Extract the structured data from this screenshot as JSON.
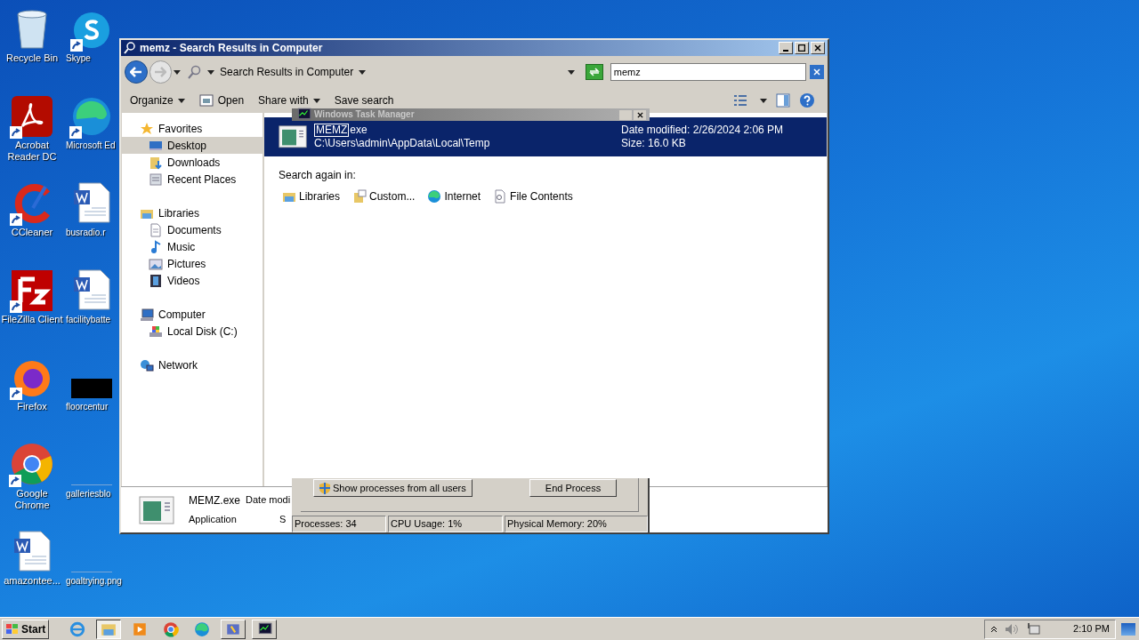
{
  "desktop_icons": [
    {
      "label": "Recycle Bin",
      "kind": "bin"
    },
    {
      "label": "Skype",
      "kind": "skype"
    },
    {
      "label": "Acrobat Reader DC",
      "kind": "acrobat"
    },
    {
      "label": "Microsoft Ed",
      "kind": "edge"
    },
    {
      "label": "CCleaner",
      "kind": "ccleaner"
    },
    {
      "label": "busradio.r",
      "kind": "word"
    },
    {
      "label": "FileZilla Client",
      "kind": "filezilla"
    },
    {
      "label": "facilitybatte",
      "kind": "word"
    },
    {
      "label": "Firefox",
      "kind": "firefox"
    },
    {
      "label": "floorcentur",
      "kind": "black"
    },
    {
      "label": "Google Chrome",
      "kind": "chrome"
    },
    {
      "label": "galleriesblo",
      "kind": "blank"
    },
    {
      "label": "amazontee...",
      "kind": "word"
    },
    {
      "label": "goaltrying.png",
      "kind": "blank"
    }
  ],
  "explorer": {
    "title": "memz - Search Results in Computer",
    "address": "Search Results in Computer",
    "search": {
      "value": "memz"
    },
    "toolbar": [
      {
        "label": "Organize",
        "kind": "menu"
      },
      {
        "label": "Open",
        "kind": "open"
      },
      {
        "label": "Share with",
        "kind": "menu"
      },
      {
        "label": "Save search",
        "kind": "plain"
      }
    ],
    "nav": [
      {
        "label": "Favorites",
        "kind": "star",
        "selected": false,
        "children": [
          {
            "label": "Desktop",
            "kind": "desktop",
            "selected": true
          },
          {
            "label": "Downloads",
            "kind": "downloads",
            "selected": false
          },
          {
            "label": "Recent Places",
            "kind": "recent",
            "selected": false
          }
        ]
      },
      {
        "label": "Libraries",
        "kind": "libraries",
        "selected": false,
        "children": [
          {
            "label": "Documents",
            "kind": "documents",
            "selected": false
          },
          {
            "label": "Music",
            "kind": "music",
            "selected": false
          },
          {
            "label": "Pictures",
            "kind": "pictures",
            "selected": false
          },
          {
            "label": "Videos",
            "kind": "videos",
            "selected": false
          }
        ]
      },
      {
        "label": "Computer",
        "kind": "computer",
        "selected": false,
        "children": [
          {
            "label": "Local Disk (C:)",
            "kind": "disk",
            "selected": false
          }
        ]
      },
      {
        "label": "Network",
        "kind": "network",
        "selected": false
      }
    ],
    "result": {
      "name_edit": "MEMZ",
      "name_rest": "exe",
      "path": "C:\\Users\\admin\\AppData\\Local\\Temp",
      "date": "Date modified: 2/26/2024 2:06 PM",
      "size": "Size: 16.0 KB",
      "selected": true
    },
    "search_again": {
      "label": "Search again in:",
      "items": [
        {
          "label": "Libraries",
          "kind": "libraries"
        },
        {
          "label": "Custom...",
          "kind": "custom"
        },
        {
          "label": "Internet",
          "kind": "internet"
        },
        {
          "label": "File Contents",
          "kind": "contents"
        }
      ]
    },
    "details": {
      "name": "MEMZ.exe",
      "date_label": "Date modi",
      "type": "Application",
      "size_label": "S"
    }
  },
  "task_manager": {
    "title": "Windows Task Manager",
    "buttons": [
      "Show processes from all users",
      "End Process"
    ],
    "status": [
      "Processes: 34",
      "CPU Usage: 1%",
      "Physical Memory: 20%"
    ]
  },
  "taskbar": {
    "start": "Start",
    "items": [
      {
        "kind": "ie",
        "selected": false
      },
      {
        "kind": "explorer",
        "selected": true
      },
      {
        "kind": "media",
        "selected": false
      },
      {
        "kind": "chrome",
        "selected": false
      },
      {
        "kind": "edge",
        "selected": false
      },
      {
        "kind": "app",
        "selected": false
      },
      {
        "kind": "taskmgr",
        "selected": false
      }
    ],
    "time": "2:10 PM"
  }
}
